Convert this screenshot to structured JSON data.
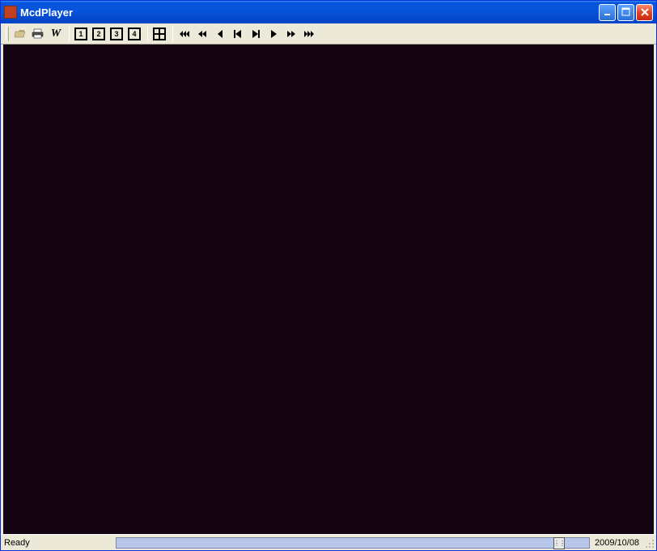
{
  "window": {
    "title": "McdPlayer"
  },
  "toolbar": {
    "view1": "1",
    "view2": "2",
    "view3": "3",
    "view4": "4"
  },
  "status": {
    "ready": "Ready",
    "date": "2009/10/08"
  }
}
